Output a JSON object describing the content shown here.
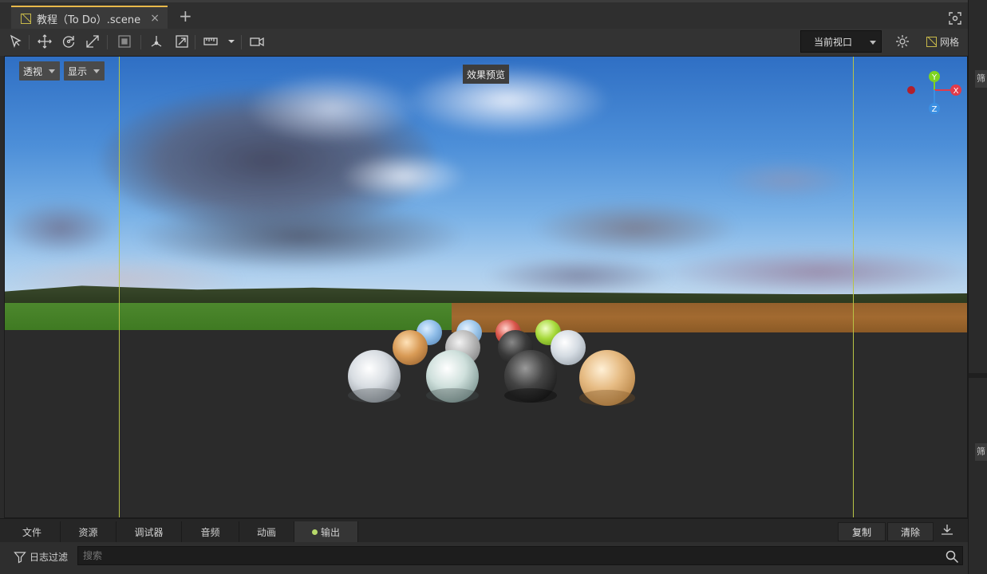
{
  "tab": {
    "title": "教程（To Do）.scene",
    "close_glyph": "×",
    "add_glyph": "+"
  },
  "toolbar": {
    "viewport_select": "当前视口",
    "grid_label": "网格"
  },
  "viewport": {
    "projection_label": "透视",
    "display_label": "显示",
    "preview_label": "效果预览",
    "gizmo_axes": {
      "y": "Y",
      "x": "X",
      "z": "Z"
    }
  },
  "right_panel": {
    "chip_top": "筛",
    "chip_bottom": "筛"
  },
  "bottom_tabs": [
    "文件",
    "资源",
    "调试器",
    "音频",
    "动画",
    "输出"
  ],
  "bottom_actions": {
    "copy": "复制",
    "clear": "清除"
  },
  "filter": {
    "label": "日志过滤",
    "search_placeholder": "搜索"
  },
  "colors": {
    "accent": "#e8b84a",
    "guide_line": "#b8c445",
    "axis_x": "#e23b4a",
    "axis_y": "#7ed321",
    "axis_z": "#3b8fe2"
  }
}
